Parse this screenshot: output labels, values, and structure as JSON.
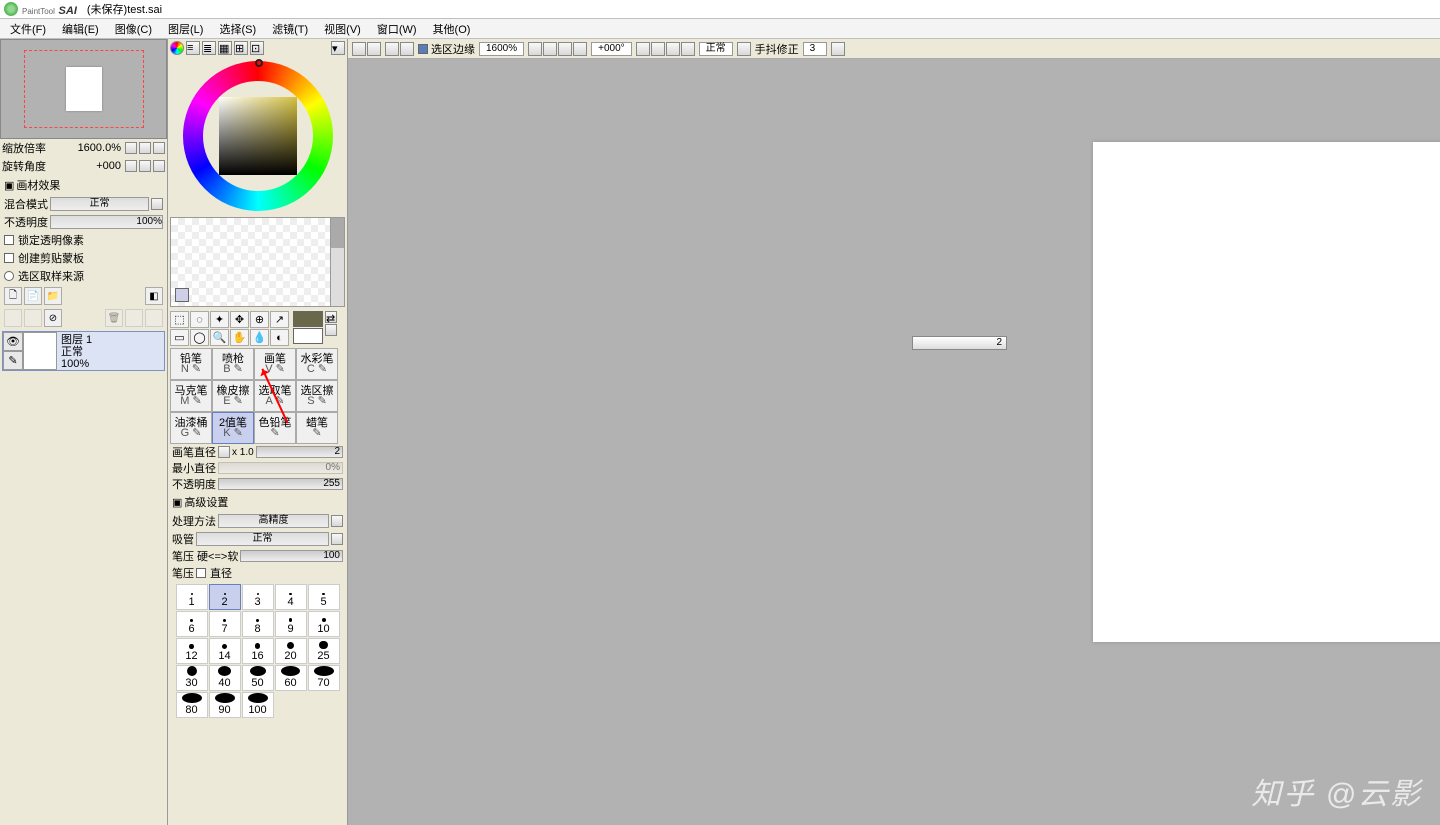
{
  "title": {
    "brand_small": "PaintTool",
    "brand": "SAI",
    "doc": "(未保存)test.sai"
  },
  "menu": [
    "文件(F)",
    "编辑(E)",
    "图像(C)",
    "图层(L)",
    "选择(S)",
    "滤镜(T)",
    "视图(V)",
    "窗口(W)",
    "其他(O)"
  ],
  "nav": {
    "zoom_label": "缩放倍率",
    "zoom_value": "1600.0%",
    "rot_label": "旋转角度",
    "rot_value": "+000"
  },
  "effects": {
    "header": "画材效果",
    "blend_label": "混合模式",
    "blend_value": "正常",
    "opacity_label": "不透明度",
    "opacity_value": "100%",
    "lock": "锁定透明像素",
    "clip": "创建剪贴蒙板",
    "sel": "选区取样来源"
  },
  "layer": {
    "name": "图层 1",
    "mode": "正常",
    "opacity": "100%"
  },
  "tools_icons_row1": [
    "⬚",
    "⬚",
    "✦",
    "✥",
    "⊕",
    "↗"
  ],
  "tools_icons_row2": [
    "⬚",
    "⬚",
    "🔍",
    "✋",
    "🎨",
    "◐"
  ],
  "brushes": [
    {
      "n": "铅笔",
      "k": "N"
    },
    {
      "n": "喷枪",
      "k": "B"
    },
    {
      "n": "画笔",
      "k": "V"
    },
    {
      "n": "水彩笔",
      "k": "C"
    },
    {
      "n": "马克笔",
      "k": "M"
    },
    {
      "n": "橡皮擦",
      "k": "E"
    },
    {
      "n": "选取笔",
      "k": "A"
    },
    {
      "n": "选区擦",
      "k": "S"
    },
    {
      "n": "油漆桶",
      "k": "G"
    },
    {
      "n": "2值笔",
      "k": "K",
      "sel": true
    },
    {
      "n": "色铅笔",
      "k": ""
    },
    {
      "n": "蜡笔",
      "k": ""
    }
  ],
  "brush_props": {
    "size_label": "画笔直径",
    "size_mult": "x 1.0",
    "size_val": "2",
    "min_label": "最小直径",
    "min_val": "0%",
    "opacity_label": "不透明度",
    "opacity_val": "255",
    "adv_header": "高级设置",
    "method_label": "处理方法",
    "method_val": "高精度",
    "pipette_label": "吸管",
    "pipette_val": "正常",
    "pressure_label": "笔压 硬<=>软",
    "pressure_val": "100",
    "pressure2_label": "笔压",
    "diameter_chk": "直径"
  },
  "sizes": [
    1,
    2,
    3,
    4,
    5,
    6,
    7,
    8,
    9,
    10,
    12,
    14,
    16,
    20,
    25,
    30,
    40,
    50,
    60,
    70,
    80,
    90,
    100
  ],
  "topbar": {
    "sel_edge": "选区边缘",
    "zoom": "1600%",
    "rot": "+000°",
    "mode": "正常",
    "stab_label": "手抖修正",
    "stab_val": "3"
  },
  "float_value": "2",
  "watermark": "知乎 @云影"
}
